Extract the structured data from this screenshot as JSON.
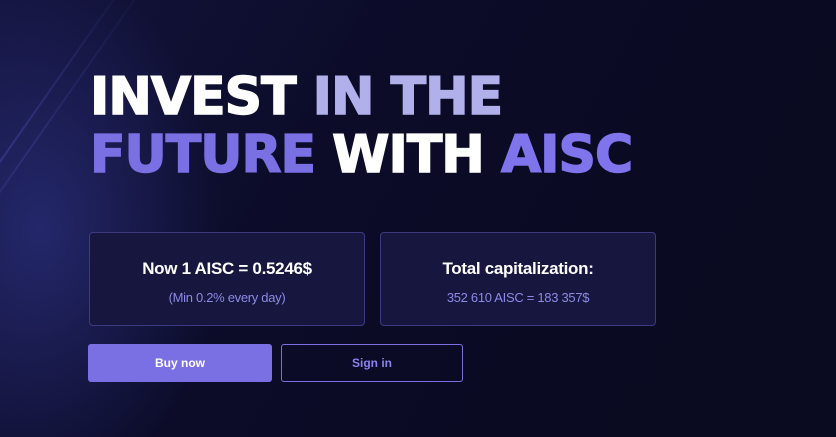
{
  "hero": {
    "line1": {
      "word1": "INVEST",
      "word2": "IN",
      "word3": "THE"
    },
    "line2": {
      "word1": "FUTURE",
      "word2": "WITH",
      "word3": "AISC"
    }
  },
  "cards": [
    {
      "title": "Now 1 AISC = 0.5246$",
      "subtitle": "(Min 0.2% every day)"
    },
    {
      "title": "Total capitalization:",
      "subtitle": "352 610 AISC = 183 357$"
    }
  ],
  "actions": {
    "buy_label": "Buy now",
    "sign_in_label": "Sign in"
  },
  "colors": {
    "background": "#0b0b26",
    "accent": "#7a70e4",
    "headline_white": "#ffffff",
    "headline_lilac": "#b1b0ea",
    "card_background": "#17163e",
    "card_border": "#3c3a82"
  }
}
